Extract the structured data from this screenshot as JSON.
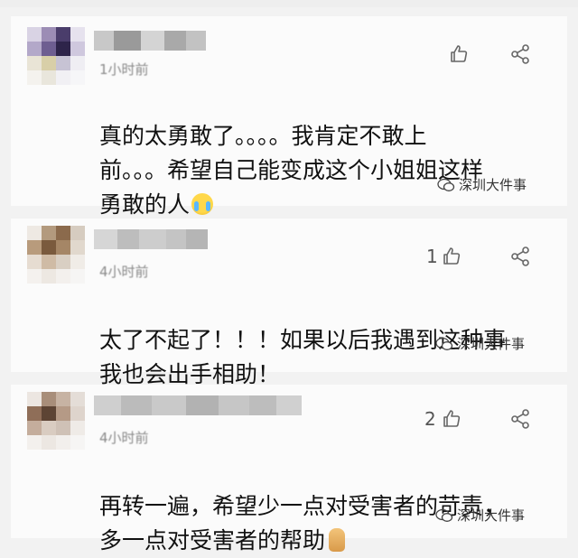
{
  "comments": [
    {
      "time": "1小时前",
      "like_count": "",
      "text": "真的太勇敢了。。。。我肯定不敢上\n前。。。希望自己能变成这个小姐姐这样\n勇敢的人",
      "emoji": "crying-face",
      "watermark": "深圳大件事"
    },
    {
      "time": "4小时前",
      "like_count": "1",
      "text": "太了不起了！！！如果以后我遇到这种事\n我也会出手相助！",
      "emoji": "",
      "watermark": "深圳大件事"
    },
    {
      "time": "4小时前",
      "like_count": "2",
      "text": "再转一遍，希望少一点对受害者的苛责，\n多一点对受害者的帮助",
      "emoji": "thumbs-up",
      "watermark": "深圳大件事"
    }
  ],
  "colors": {
    "background": "#f2f2f2",
    "text": "#111111",
    "muted": "#8a8a8a"
  },
  "icons": [
    "thumbs-up-icon",
    "share-icon",
    "wechat-watermark-icon"
  ]
}
